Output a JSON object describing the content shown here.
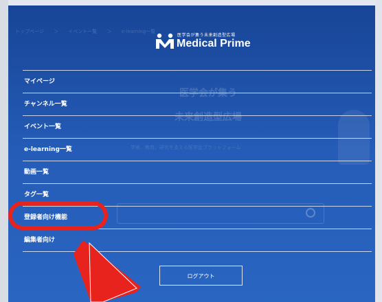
{
  "background_page": {
    "breadcrumb": "トップページ ＞ イベント一覧 ＞ e-learning一覧",
    "hero_line1": "医学会が集う",
    "hero_line2": "未来創造型広場",
    "hero_sub": "学術、教育、研究を支える医学会プラットフォーム"
  },
  "logo": {
    "tagline": "医学会が集う未来創造型広場",
    "name": "Medical Prime"
  },
  "menu": {
    "items": [
      {
        "label": "マイページ"
      },
      {
        "label": "チャンネル一覧"
      },
      {
        "label": "イベント一覧"
      },
      {
        "label": "e-learning一覧"
      },
      {
        "label": "動画一覧"
      },
      {
        "label": "タグ一覧"
      },
      {
        "label": "登録者向け機能"
      },
      {
        "label": "編集者向け"
      }
    ]
  },
  "logout_label": "ログアウト",
  "annotation": {
    "highlight_color": "#e8221d",
    "highlighted_item": "登録者向け機能"
  },
  "colors": {
    "panel_top": "#1c4ea0",
    "panel_bottom": "#2c6cc8",
    "text": "#ffffff"
  }
}
